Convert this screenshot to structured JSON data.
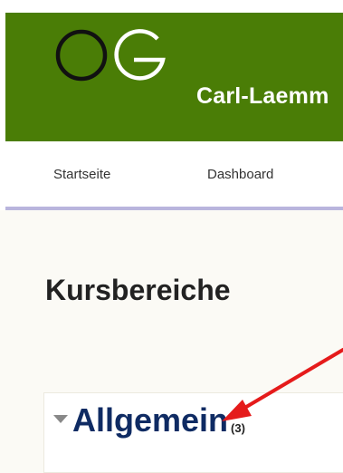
{
  "header": {
    "logo_icon": "og-logo-icon",
    "site_title": "Carl-Laemm",
    "background_color": "#4a7d06"
  },
  "nav": {
    "items": [
      {
        "label": "Startseite"
      },
      {
        "label": "Dashboard"
      }
    ]
  },
  "main": {
    "title": "Kursbereiche",
    "categories": [
      {
        "name": "Allgemein",
        "count": "(3)",
        "expand_icon": "collapse-triangle-icon"
      }
    ]
  },
  "annotation": {
    "type": "red-arrow",
    "color": "#e51b1b",
    "target": "category-link"
  }
}
